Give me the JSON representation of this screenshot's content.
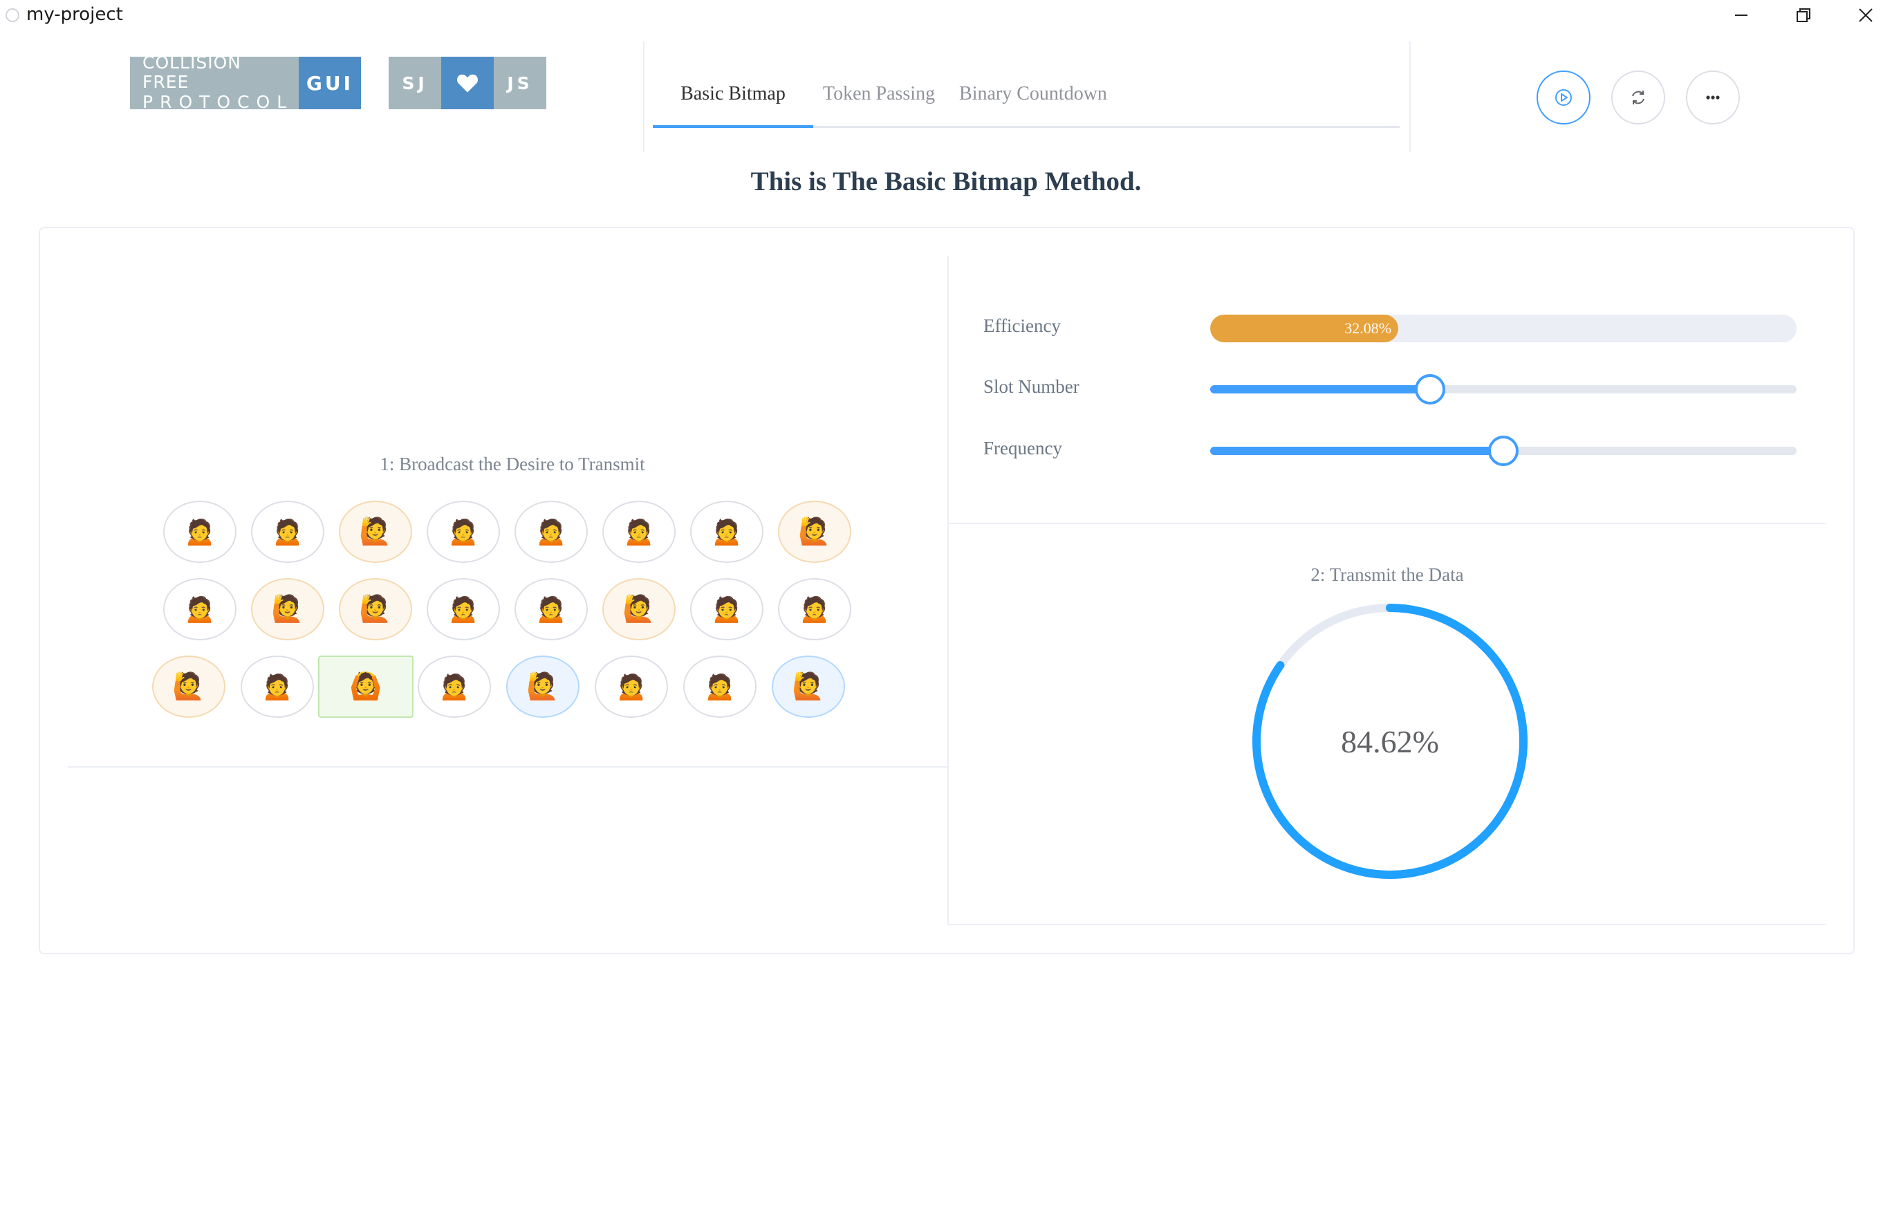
{
  "window": {
    "title": "my-project"
  },
  "badges": {
    "collision": {
      "line1": "COLLISION  FREE",
      "line2": "PROTOCOL",
      "right": "GUI"
    },
    "sjjs": {
      "left": "SJ",
      "right": "JS",
      "heart_icon": "heart-icon"
    }
  },
  "tabs": [
    {
      "label": "Basic Bitmap",
      "active": true
    },
    {
      "label": "Token Passing",
      "active": false
    },
    {
      "label": "Binary Countdown",
      "active": false
    }
  ],
  "toolbar": {
    "play_icon": "play-icon",
    "refresh_icon": "refresh-icon",
    "more_icon": "more-icon"
  },
  "heading": "This is The Basic Bitmap Method.",
  "broadcast": {
    "label": "1: Broadcast the Desire to Transmit",
    "rows": [
      [
        "🙍",
        "🙍",
        "🙋",
        "🙍",
        "🙍",
        "🙍",
        "🙍",
        "🙋"
      ],
      [
        "🙍",
        "🙋",
        "🙋",
        "🙍",
        "🙍",
        "🙋",
        "🙍",
        "🙍"
      ],
      [
        "🙋",
        "🙍",
        "🙆",
        "🙍",
        "🙋",
        "🙍",
        "🙍",
        "🙋"
      ]
    ],
    "states": [
      [
        "default",
        "default",
        "want",
        "default",
        "default",
        "default",
        "default",
        "want"
      ],
      [
        "default",
        "want",
        "want",
        "default",
        "default",
        "want",
        "default",
        "default"
      ],
      [
        "want",
        "default",
        "active",
        "default",
        "send",
        "default",
        "default",
        "send"
      ]
    ]
  },
  "settings": {
    "efficiency": {
      "label": "Efficiency",
      "value_text": "32.08%",
      "fraction": 0.3208
    },
    "slot_number": {
      "label": "Slot Number",
      "fraction": 0.375
    },
    "frequency": {
      "label": "Frequency",
      "fraction": 0.5
    }
  },
  "transmit": {
    "label": "2: Transmit the Data",
    "percent_text": "84.62%",
    "fraction": 0.8462
  },
  "colors": {
    "primary": "#409eff",
    "warning": "#e6a23c",
    "success_bg": "#f0f9eb",
    "badge_gray": "#a5b7bd",
    "badge_blue": "#4e8cc5"
  }
}
